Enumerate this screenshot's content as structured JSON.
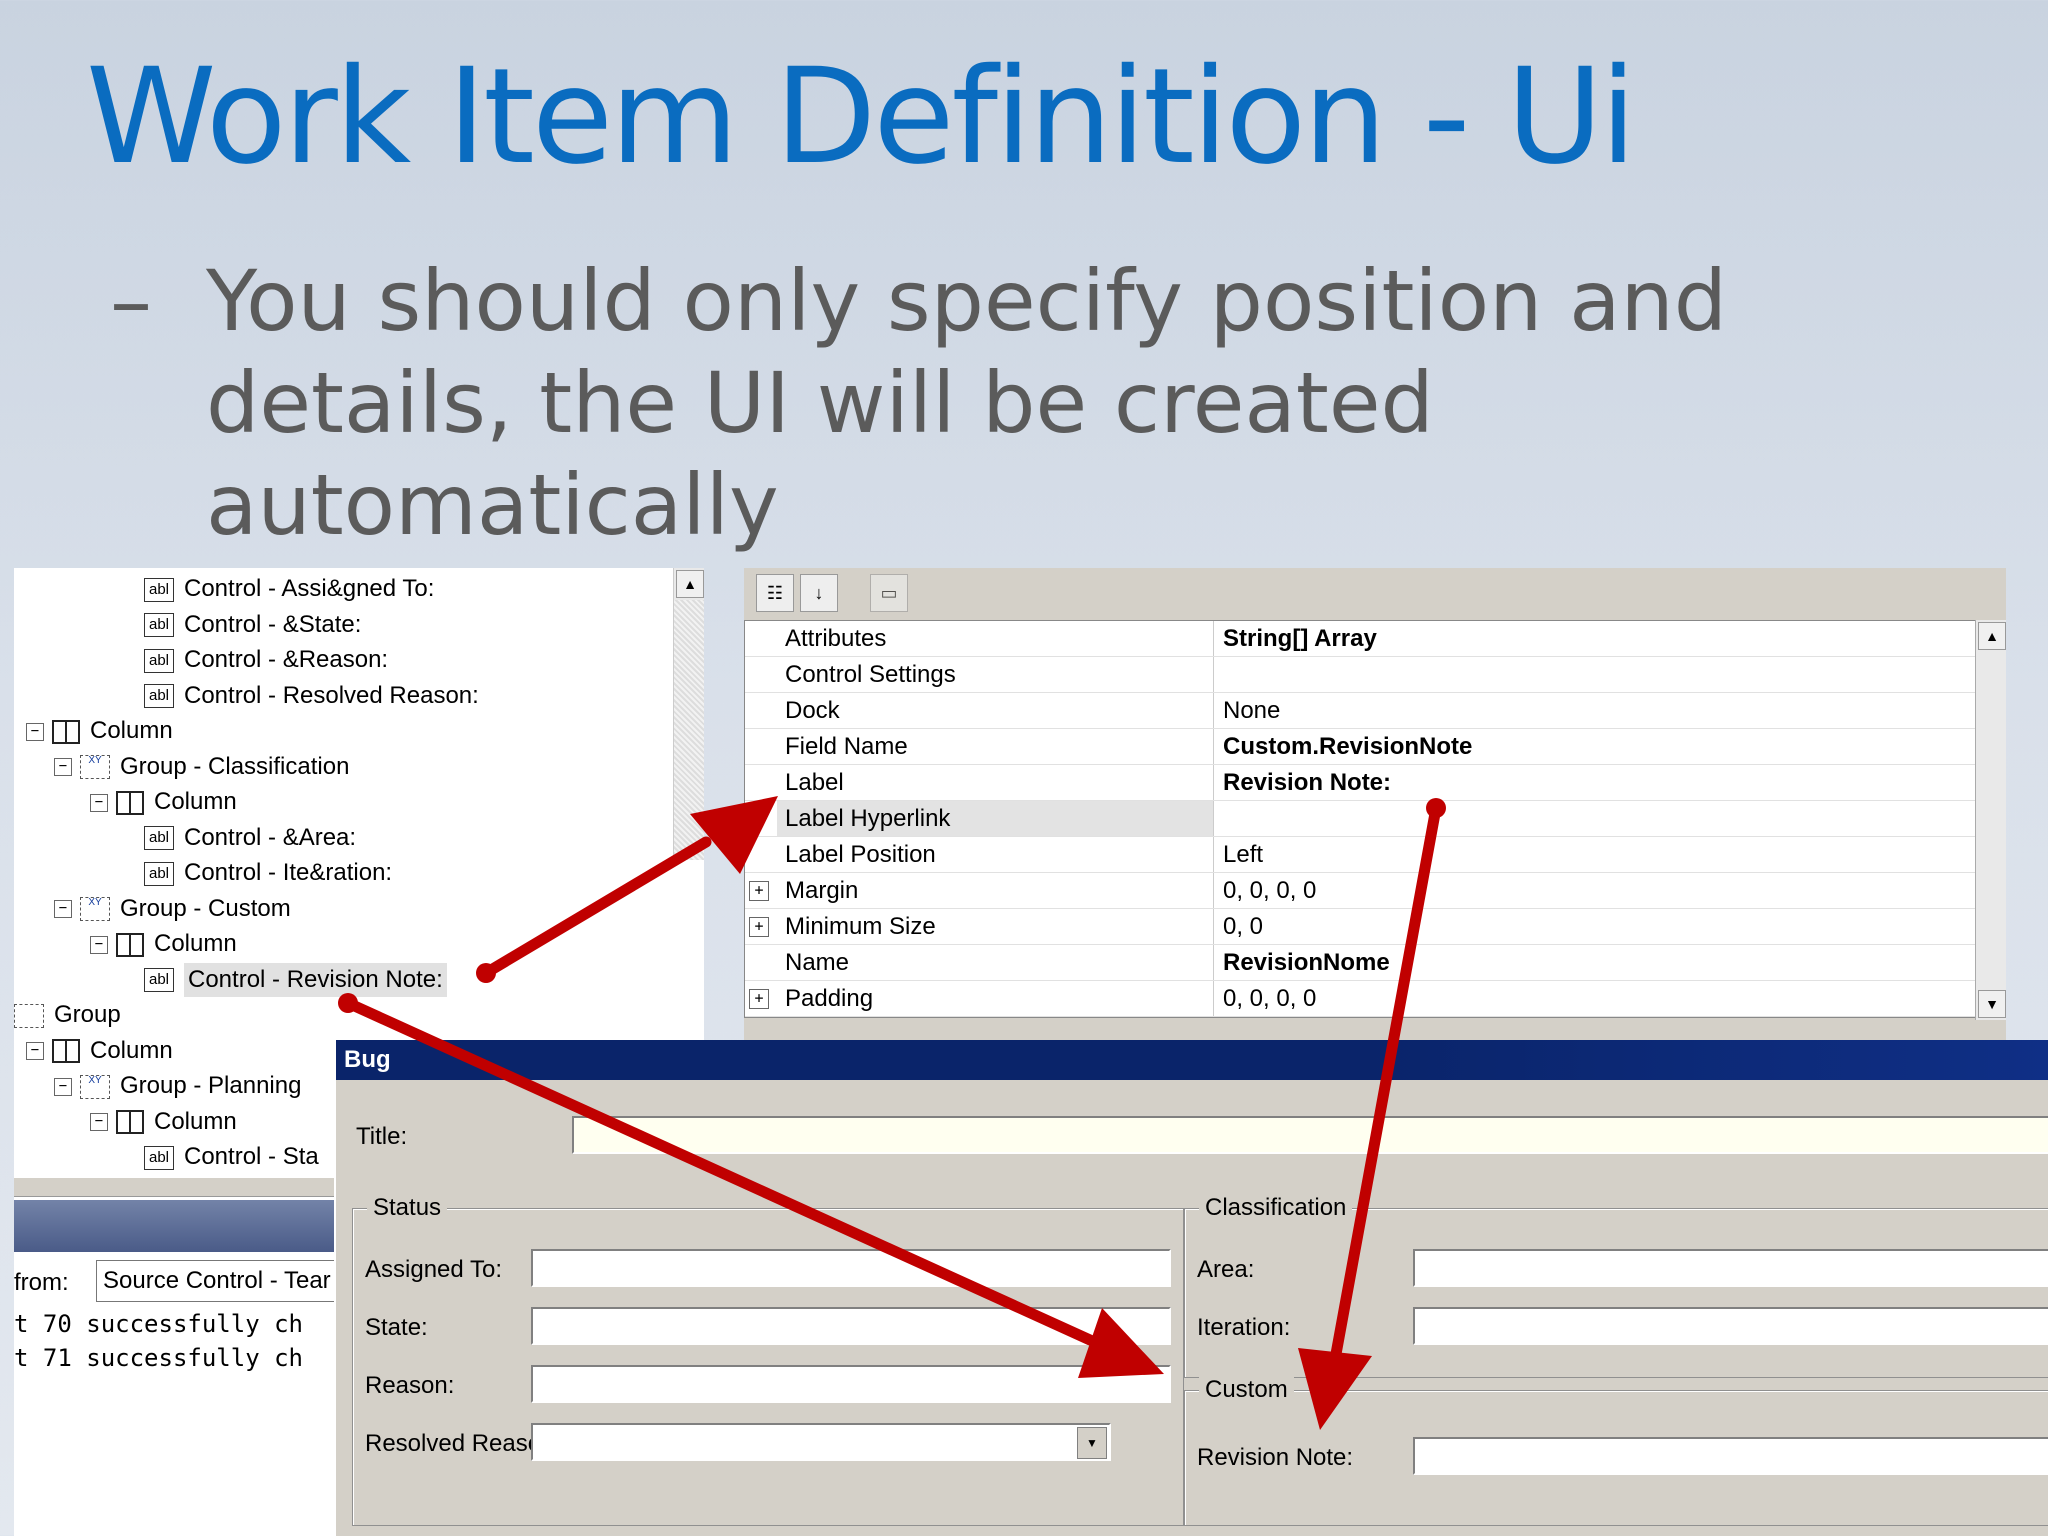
{
  "slide": {
    "title": "Work Item Definition - Ui",
    "bullet_dash": "–",
    "bullet": "You should only specify position and details, the UI will be created automatically"
  },
  "tree": {
    "rows": [
      {
        "label": "Control - Assi&gned To:",
        "icon": "abl-icon",
        "abl": "abl"
      },
      {
        "label": "Control - &State:",
        "icon": "abl-icon",
        "abl": "abl"
      },
      {
        "label": "Control - &Reason:",
        "icon": "abl-icon",
        "abl": "abl"
      },
      {
        "label": "Control - Resolved Reason:",
        "icon": "abl-icon",
        "abl": "abl"
      },
      {
        "label": "Column",
        "icon": "column-icon"
      },
      {
        "label": "Group - Classification",
        "icon": "group-icon",
        "grp": "XY"
      },
      {
        "label": "Column",
        "icon": "column-icon"
      },
      {
        "label": "Control - &Area:",
        "icon": "abl-icon",
        "abl": "abl"
      },
      {
        "label": "Control - Ite&ration:",
        "icon": "abl-icon",
        "abl": "abl"
      },
      {
        "label": "Group - Custom",
        "icon": "group-icon",
        "grp": "XY"
      },
      {
        "label": "Column",
        "icon": "column-icon"
      },
      {
        "label": "Control - Revision Note:",
        "icon": "abl-icon",
        "abl": "abl",
        "selected": true
      },
      {
        "label": "Group",
        "icon": "group-icon"
      },
      {
        "label": "Column",
        "icon": "column-icon"
      },
      {
        "label": "Group - Planning",
        "icon": "group-icon",
        "grp": "XY"
      },
      {
        "label": "Column",
        "icon": "column-icon"
      },
      {
        "label": "Control - Sta",
        "icon": "abl-icon",
        "abl": "abl"
      }
    ]
  },
  "output": {
    "from_label": "from:",
    "source": "Source Control - Tear",
    "lines": [
      "t 70 successfully ch",
      "t 71 successfully ch"
    ]
  },
  "props": {
    "rows": [
      {
        "name": "Attributes",
        "value": "String[] Array",
        "bold": true
      },
      {
        "name": "Control Settings",
        "value": ""
      },
      {
        "name": "Dock",
        "value": "None"
      },
      {
        "name": "Field Name",
        "value": "Custom.RevisionNote",
        "bold": true
      },
      {
        "name": "Label",
        "value": "Revision Note:",
        "bold": true
      },
      {
        "name": "Label Hyperlink",
        "value": "",
        "selected": true
      },
      {
        "name": "Label Position",
        "value": "Left"
      },
      {
        "name": "Margin",
        "value": "0, 0, 0, 0",
        "expandable": true
      },
      {
        "name": "Minimum Size",
        "value": "0, 0",
        "expandable": true
      },
      {
        "name": "Name",
        "value": "RevisionNome",
        "bold": true
      },
      {
        "name": "Padding",
        "value": "0, 0, 0, 0",
        "expandable": true
      }
    ]
  },
  "bug": {
    "window_title": "Bug",
    "title_label": "Title:",
    "status": {
      "caption": "Status",
      "assigned_to": "Assigned To:",
      "state": "State:",
      "reason": "Reason:",
      "resolved_reason": "Resolved Reason:"
    },
    "classification": {
      "caption": "Classification",
      "area": "Area:",
      "iteration": "Iteration:"
    },
    "custom": {
      "caption": "Custom",
      "revision_note": "Revision Note:"
    }
  },
  "colors": {
    "title": "#0a6cc0",
    "arrow": "#c00000",
    "titlebar": "#0a246a"
  }
}
